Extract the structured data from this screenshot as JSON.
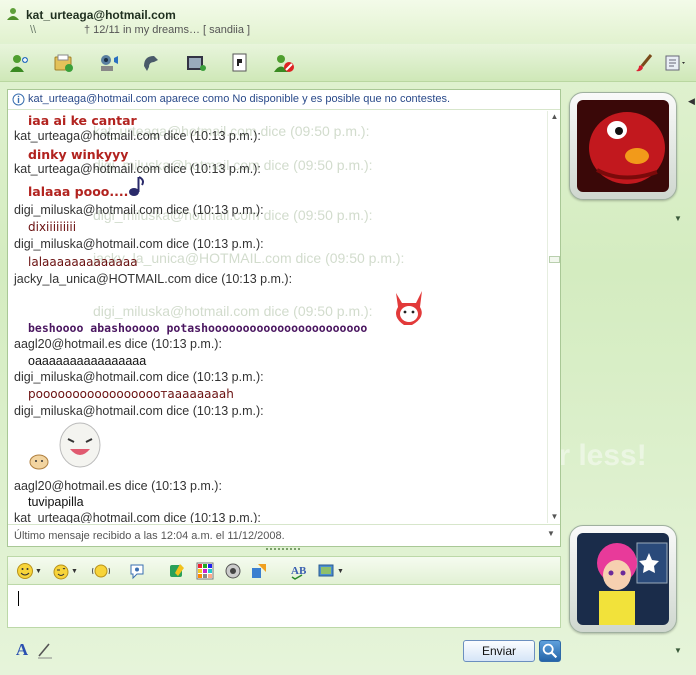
{
  "header": {
    "contact_email": "kat_urteaga@hotmail.com",
    "status_icon_text": "\\\\",
    "personal_message": "† 12/11  in my dreams… [ sandiia ]"
  },
  "toolbar": {
    "items": [
      {
        "name": "invite-contact-icon"
      },
      {
        "name": "send-files-icon"
      },
      {
        "name": "video-call-icon"
      },
      {
        "name": "voice-call-icon"
      },
      {
        "name": "activities-icon"
      },
      {
        "name": "games-icon"
      },
      {
        "name": "block-contact-icon"
      }
    ],
    "right_items": [
      {
        "name": "paint-brush-icon"
      },
      {
        "name": "options-menu-icon"
      }
    ]
  },
  "chat": {
    "warning": "kat_urteaga@hotmail.com aparece como No disponible y es posible que no contestes.",
    "messages": [
      {
        "kind": "msg-red",
        "text": "iaa ai ke cantar"
      },
      {
        "kind": "sender",
        "text": "kat_urteaga@hotmail.com dice (10:13 p.m.):"
      },
      {
        "kind": "msg-red",
        "text": "dinky winkyyy"
      },
      {
        "kind": "sender",
        "text": "kat_urteaga@hotmail.com dice (10:13 p.m.):"
      },
      {
        "kind": "msg-red",
        "text": "lalaaa pooo...."
      },
      {
        "kind": "sender",
        "text": "digi_miluska@hotmail.com dice (10:13 p.m.):"
      },
      {
        "kind": "msg-darkred",
        "text": "dixiiiiiiiii"
      },
      {
        "kind": "sender",
        "text": "digi_miluska@hotmail.com dice (10:13 p.m.):"
      },
      {
        "kind": "msg-darkred",
        "text": "lalaaaaaaaaaaaaa"
      },
      {
        "kind": "sender",
        "text": "jacky_la_unica@HOTMAIL.com dice (10:13 p.m.):"
      },
      {
        "kind": "msg-purple",
        "text": "beshoooo abashooooo potashooooooooooooooooooooooo"
      },
      {
        "kind": "sender",
        "text": "aagl20@hotmail.es dice (10:13 p.m.):"
      },
      {
        "kind": "msg-plain",
        "text": "oaaaaaaaaaaaaaaaa"
      },
      {
        "kind": "sender",
        "text": "digi_miluska@hotmail.com dice (10:13 p.m.):"
      },
      {
        "kind": "msg-darkred",
        "text": "poooooooooooooooooтaaaaaaaah"
      },
      {
        "kind": "sender",
        "text": "digi_miluska@hotmail.com dice (10:13 p.m.):"
      },
      {
        "kind": "sender",
        "text": "aagl20@hotmail.es dice (10:13 p.m.):"
      },
      {
        "kind": "msg-plain",
        "text": "tuvipapilla"
      },
      {
        "kind": "sender",
        "text": "kat_urteaga@hotmail.com dice (10:13 p.m.):"
      }
    ],
    "last_message": "Último mensaje recibido a las 12:04 a.m. el 11/12/2008."
  },
  "input_toolbar": {
    "items": [
      {
        "name": "emoticons-icon",
        "dropdown": true
      },
      {
        "name": "winks-icon",
        "dropdown": true
      },
      {
        "name": "nudge-icon"
      },
      {
        "name": "voice-clip-icon"
      },
      {
        "name": "animoticon-icon"
      },
      {
        "name": "backgrounds-icon"
      },
      {
        "name": "sounds-icon"
      },
      {
        "name": "share-icon"
      },
      {
        "name": "spell-check-icon"
      },
      {
        "name": "change-display-icon",
        "dropdown": true
      }
    ]
  },
  "input": {
    "value": ""
  },
  "bottom": {
    "font_label": "A",
    "send_label": "Enviar"
  },
  "colors": {
    "accent_green": "#cfe8b8",
    "red_text": "#b2231f",
    "purple_text": "#4a1660",
    "link_blue": "#2a4a8a"
  },
  "ghost_texts": [
    "kat_urteaga@hotmail.com dice (09:50 p.m.):",
    "digi_miluska@hotmail.com dice (09:50 p.m.):",
    "digi_miluska@hotmail.com dice (09:50 p.m.):",
    "jacky_la_unica@HOTMAIL.com dice (09:50 p.m.):",
    "digi_miluska@hotmail.com dice (09:50 p.m.):",
    "for less!"
  ]
}
